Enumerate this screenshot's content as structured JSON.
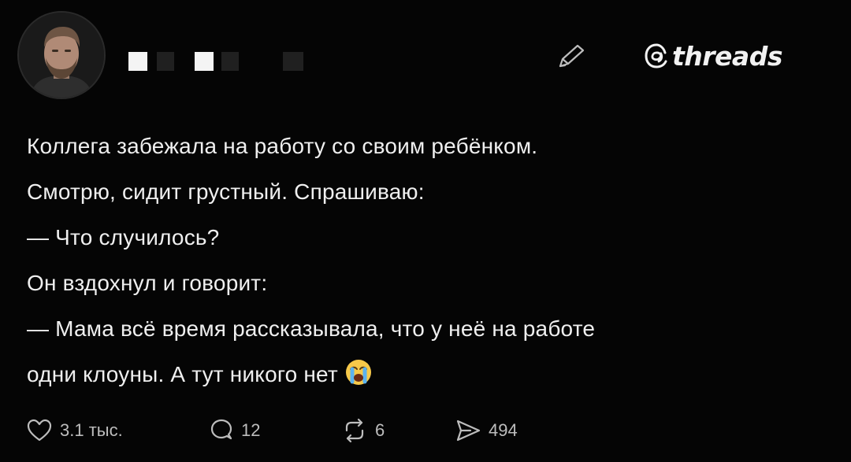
{
  "author": {
    "avatar": "user-avatar-photo"
  },
  "header": {
    "brand_text": "threads",
    "edit_icon": "pencil-icon"
  },
  "post": {
    "lines": [
      "Коллега забежала на работу со своим ребёнком.",
      "Смотрю, сидит грустный. Спрашиваю:",
      "— Что случилось?",
      "Он вздохнул и говорит:",
      "— Мама всё время рассказывала, что у неё на работе",
      "одни клоуны. А тут никого нет"
    ],
    "emoji": "crying-face-emoji"
  },
  "actions": {
    "likes": "3.1 тыс.",
    "replies": "12",
    "reposts": "6",
    "shares": "494"
  },
  "colors": {
    "background": "#050505",
    "text": "#efefef",
    "muted": "#bdbdbd"
  }
}
